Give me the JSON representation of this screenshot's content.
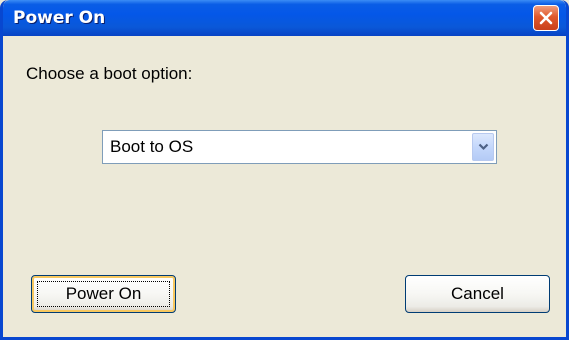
{
  "window": {
    "title": "Power On"
  },
  "dialog": {
    "prompt": "Choose a boot option:",
    "boot_select": {
      "selected": "Boot to OS"
    },
    "buttons": {
      "power_on": "Power On",
      "cancel": "Cancel"
    }
  },
  "icons": {
    "close": "close-icon",
    "dropdown": "chevron-down-icon"
  },
  "colors": {
    "titlebar": "#0457e8",
    "close_button": "#e0582c",
    "dialog_background": "#ece9d8",
    "button_border": "#003c74"
  }
}
